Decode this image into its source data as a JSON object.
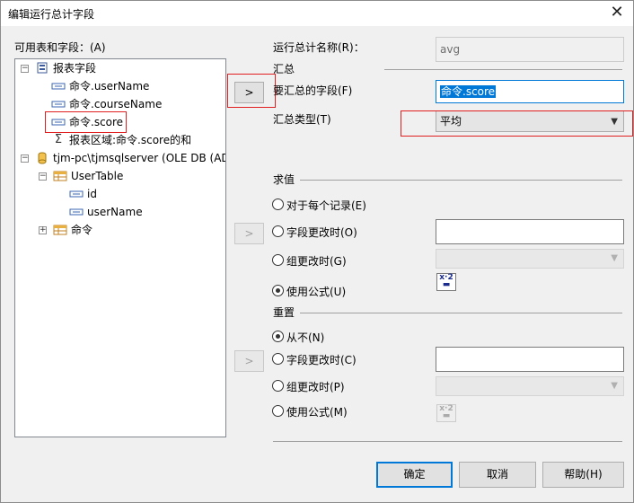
{
  "window": {
    "title": "编辑运行总计字段",
    "close_glyph": "✕"
  },
  "left": {
    "label": "可用表和字段：(A)",
    "tree": {
      "report_fields": "报表字段",
      "field_username": "命令.userName",
      "field_coursename": "命令.courseName",
      "field_score": "命令.score",
      "field_sum": "报表区域:命令.score的和",
      "datasource": "tjm-pc\\tjmsqlserver (OLE DB (AD",
      "usertable": "UserTable",
      "col_id": "id",
      "col_username": "userName",
      "command": "命令"
    }
  },
  "arrows": {
    "add_summary": ">",
    "add_eval": ">",
    "add_reset": ">"
  },
  "right": {
    "name_label": "运行总计名称(R)：",
    "name_value": "avg",
    "summary_group": "汇总",
    "field_to_summarize_label": "要汇总的字段(F)",
    "field_to_summarize_value": "命令.score",
    "summary_type_label": "汇总类型(T)",
    "summary_type_value": "平均",
    "evaluate_group": "求值",
    "eval_each_record": "对于每个记录(E)",
    "eval_on_field_change": "字段更改时(O)",
    "eval_on_group_change": "组更改时(G)",
    "eval_use_formula": "使用公式(U)",
    "eval_selected": "eval_use_formula",
    "reset_group": "重置",
    "reset_never": "从不(N)",
    "reset_on_field_change": "字段更改时(C)",
    "reset_on_group_change": "组更改时(P)",
    "reset_use_formula": "使用公式(M)",
    "reset_selected": "reset_never",
    "formula_icon_text": "x·2"
  },
  "footer": {
    "ok": "确定",
    "cancel": "取消",
    "help": "帮助(H)"
  },
  "colors": {
    "accent": "#0078d7",
    "highlight_border": "#e02020"
  }
}
